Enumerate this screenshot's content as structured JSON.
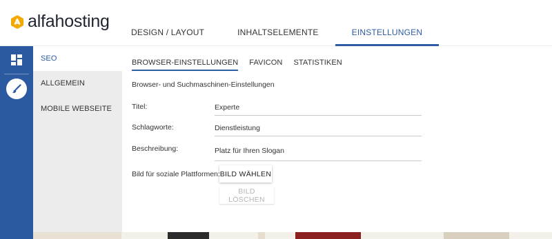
{
  "header": {
    "logo_text": "alfahosting",
    "nav": [
      {
        "label": "DESIGN / LAYOUT",
        "active": false
      },
      {
        "label": "INHALTSELEMENTE",
        "active": false
      },
      {
        "label": "EINSTELLUNGEN",
        "active": true
      }
    ]
  },
  "rail": {
    "items": [
      {
        "icon": "dashboard-grid-icon"
      },
      {
        "icon": "paintbrush-icon"
      }
    ]
  },
  "sidebar": {
    "items": [
      {
        "label": "SEO",
        "active": true
      },
      {
        "label": "ALLGEMEIN",
        "active": false
      },
      {
        "label": "MOBILE WEBSEITE",
        "active": false
      }
    ]
  },
  "tabs": [
    {
      "label": "BROWSER-EINSTELLUNGEN",
      "active": true
    },
    {
      "label": "FAVICON",
      "active": false
    },
    {
      "label": "STATISTIKEN",
      "active": false
    }
  ],
  "section": {
    "title": "Browser- und Suchmaschinen-Einstellungen"
  },
  "fields": [
    {
      "label": "Titel:",
      "value": "Experte"
    },
    {
      "label": "Schlagworte:",
      "value": "Dienstleistung"
    },
    {
      "label": "Beschreibung:",
      "value": "Platz für Ihren Slogan"
    }
  ],
  "social_image": {
    "label": "Bild für soziale Plattformen:",
    "choose_button": "BILD WÄHLEN",
    "delete_button": "BILD LÖSCHEN"
  },
  "colors": {
    "accent": "#2d5ba4",
    "rail": "#2c5aa0",
    "logo_mark": "#f2a900"
  }
}
